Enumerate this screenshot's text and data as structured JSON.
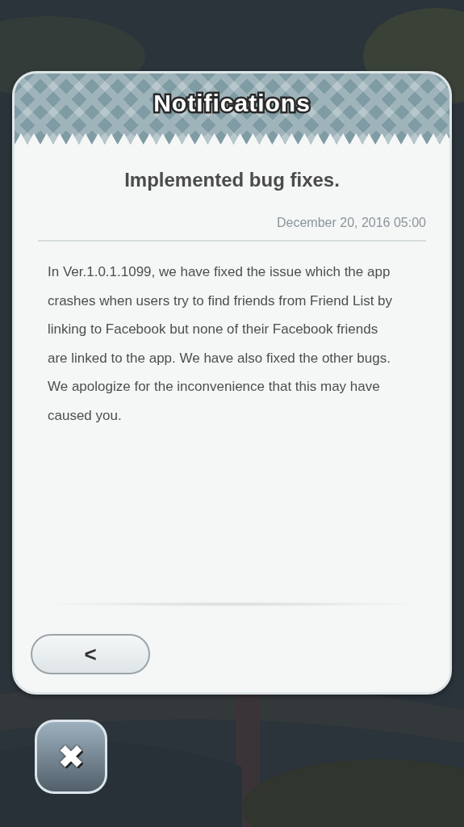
{
  "dialog": {
    "title": "Notifications",
    "heading": "Implemented bug fixes.",
    "date": "December 20, 2016 05:00",
    "paragraphs": [
      "In Ver.1.0.1.1099, we have fixed the issue which the app crashes when users try to find friends from Friend List by linking to Facebook but none of their Facebook friends are linked to the app. We have also fixed the other bugs.",
      "We apologize for the inconvenience that this may have caused you."
    ],
    "back_button": {
      "label": "<"
    }
  },
  "close_button": {
    "label": "✖"
  }
}
